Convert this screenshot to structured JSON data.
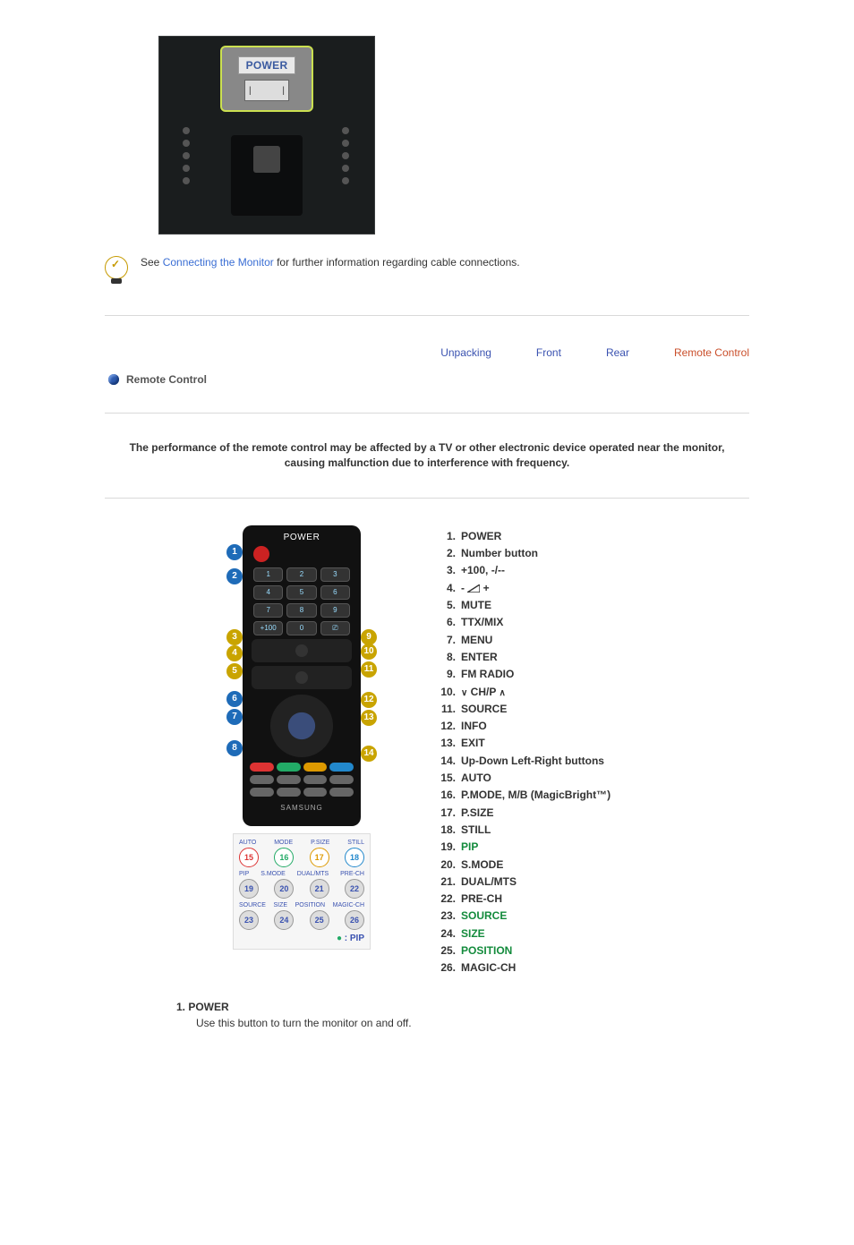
{
  "photo": {
    "power_label": "POWER"
  },
  "info": {
    "prefix": "See ",
    "link": "Connecting the Monitor",
    "suffix": " for further information regarding cable connections."
  },
  "tabs": {
    "unpacking": "Unpacking",
    "front": "Front",
    "rear": "Rear",
    "remote": "Remote Control"
  },
  "section_title": "Remote Control",
  "warning": "The performance of the remote control may be affected by a TV or other electronic device operated near the monitor, causing malfunction due to interference with frequency.",
  "remote": {
    "title": "POWER",
    "brand": "SAMSUNG",
    "legend": " : PIP",
    "foot_labels_1": [
      "AUTO",
      "MODE",
      "P.SIZE",
      "STILL"
    ],
    "foot_nums_1": [
      "15",
      "16",
      "17",
      "18"
    ],
    "foot_labels_2": [
      "PIP",
      "S.MODE",
      "DUAL/MTS",
      "PRE-CH"
    ],
    "foot_nums_2": [
      "19",
      "20",
      "21",
      "22"
    ],
    "foot_labels_3": [
      "SOURCE",
      "SIZE",
      "POSITION",
      "MAGIC-CH"
    ],
    "foot_nums_3": [
      "23",
      "24",
      "25",
      "26"
    ]
  },
  "list": [
    {
      "n": "1.",
      "label": "POWER",
      "green": false
    },
    {
      "n": "2.",
      "label": "Number button",
      "green": false
    },
    {
      "n": "3.",
      "label": "+100, -/--",
      "green": false
    },
    {
      "n": "4.",
      "label": "-     +",
      "green": false,
      "vol": true
    },
    {
      "n": "5.",
      "label": "MUTE",
      "green": false
    },
    {
      "n": "6.",
      "label": "TTX/MIX",
      "green": false
    },
    {
      "n": "7.",
      "label": "MENU",
      "green": false
    },
    {
      "n": "8.",
      "label": "ENTER",
      "green": false
    },
    {
      "n": "9.",
      "label": "FM RADIO",
      "green": false
    },
    {
      "n": "10.",
      "label": "CH/P",
      "green": false,
      "chp": true
    },
    {
      "n": "11.",
      "label": "SOURCE",
      "green": false
    },
    {
      "n": "12.",
      "label": "INFO",
      "green": false
    },
    {
      "n": "13.",
      "label": "EXIT",
      "green": false
    },
    {
      "n": "14.",
      "label": "Up-Down Left-Right buttons",
      "green": false
    },
    {
      "n": "15.",
      "label": "AUTO",
      "green": false
    },
    {
      "n": "16.",
      "label": "P.MODE, M/B (MagicBright™)",
      "green": false
    },
    {
      "n": "17.",
      "label": "P.SIZE",
      "green": false
    },
    {
      "n": "18.",
      "label": "STILL",
      "green": false
    },
    {
      "n": "19.",
      "label": "PIP",
      "green": true
    },
    {
      "n": "20.",
      "label": "S.MODE",
      "green": false
    },
    {
      "n": "21.",
      "label": "DUAL/MTS",
      "green": false
    },
    {
      "n": "22.",
      "label": "PRE-CH",
      "green": false
    },
    {
      "n": "23.",
      "label": "SOURCE",
      "green": true
    },
    {
      "n": "24.",
      "label": "SIZE",
      "green": true
    },
    {
      "n": "25.",
      "label": "POSITION",
      "green": true
    },
    {
      "n": "26.",
      "label": "MAGIC-CH",
      "green": false
    }
  ],
  "detail": {
    "num": "1. ",
    "title": "POWER",
    "desc": "Use this button to turn the monitor on and off."
  }
}
